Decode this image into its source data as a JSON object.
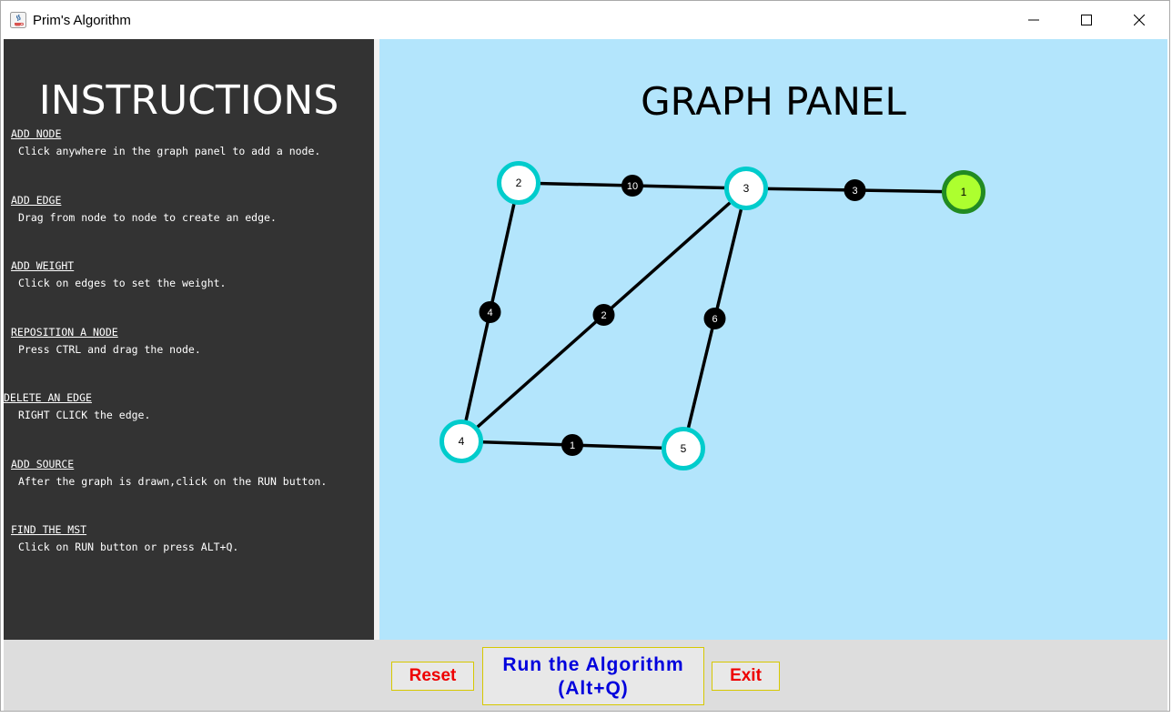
{
  "window": {
    "title": "Prim's Algorithm"
  },
  "instructions": {
    "title": "INSTRUCTIONS",
    "items": [
      {
        "heading": "ADD NODE",
        "text": "Click anywhere in the graph panel to add a node."
      },
      {
        "heading": "ADD EDGE",
        "text": "Drag from node to node to create an edge."
      },
      {
        "heading": "ADD WEIGHT",
        "text": "Click on edges to set the weight."
      },
      {
        "heading": "REPOSITION A NODE",
        "text": "Press CTRL and drag the node."
      },
      {
        "heading": "DELETE AN EDGE",
        "text": "RIGHT CLICK the edge."
      },
      {
        "heading": "ADD SOURCE",
        "text": "After the graph is drawn,click on the RUN button."
      },
      {
        "heading": "FIND THE MST",
        "text": "Click on RUN button or press ALT+Q."
      }
    ]
  },
  "graph": {
    "title": "GRAPH PANEL",
    "colors": {
      "background": "#b3e5fc",
      "node_ring": "#00cccc",
      "source_ring": "#228b22",
      "source_fill": "#adff2f",
      "edge": "#000000",
      "weight_bg": "#000000"
    },
    "nodes": [
      {
        "id": "2",
        "label": "2",
        "source": false
      },
      {
        "id": "3",
        "label": "3",
        "source": false
      },
      {
        "id": "1",
        "label": "1",
        "source": true
      },
      {
        "id": "4",
        "label": "4",
        "source": false
      },
      {
        "id": "5",
        "label": "5",
        "source": false
      }
    ],
    "edges": [
      {
        "from": "2",
        "to": "3",
        "weight": "10"
      },
      {
        "from": "3",
        "to": "1",
        "weight": "3"
      },
      {
        "from": "2",
        "to": "4",
        "weight": "4"
      },
      {
        "from": "3",
        "to": "4",
        "weight": "2"
      },
      {
        "from": "3",
        "to": "5",
        "weight": "6"
      },
      {
        "from": "4",
        "to": "5",
        "weight": "1"
      }
    ]
  },
  "buttons": {
    "reset": "Reset",
    "run_line1": "Run the Algorithm",
    "run_line2": "(Alt+Q)",
    "exit": "Exit"
  }
}
